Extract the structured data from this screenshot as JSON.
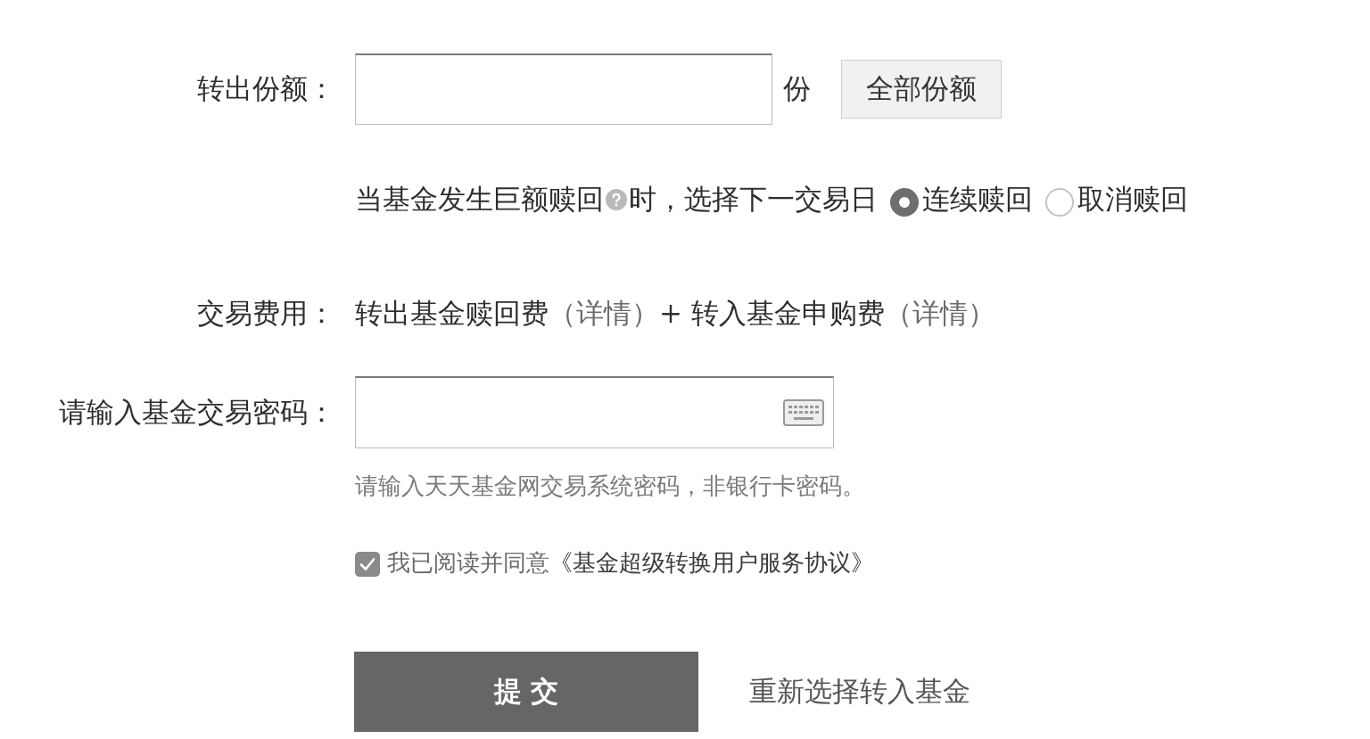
{
  "transfer_form": {
    "share_field": {
      "label": "转出份额：",
      "unit": "份",
      "all_button": "全部份额"
    },
    "large_redemption": {
      "prompt_before": "当基金发生巨额赎回",
      "prompt_after": "时，选择下一交易日",
      "options": [
        {
          "label": "连续赎回",
          "selected": true
        },
        {
          "label": "取消赎回",
          "selected": false
        }
      ]
    },
    "fees": {
      "label": "交易费用：",
      "parts": [
        {
          "kind": "text",
          "text": "转出基金赎回费"
        },
        {
          "kind": "link",
          "text": "（详情）"
        },
        {
          "kind": "text",
          "text": "+ 转入基金申购费"
        },
        {
          "kind": "link",
          "text": "（详情）"
        }
      ]
    },
    "password": {
      "label": "请输入基金交易密码：",
      "hint": "请输入天天基金网交易系统密码，非银行卡密码。"
    },
    "agreement": {
      "checked": true,
      "text": "我已阅读并同意",
      "link": "《基金超级转换用户服务协议》"
    },
    "actions": {
      "submit": "提 交",
      "reselect_link": "重新选择转入基金"
    }
  }
}
